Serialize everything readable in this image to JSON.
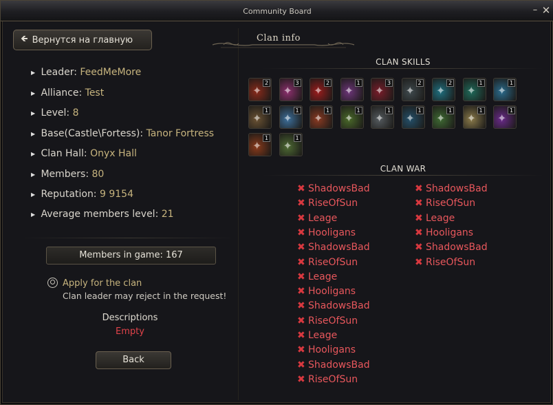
{
  "window": {
    "title": "Community Board",
    "minimize": "–",
    "close": "✕"
  },
  "home_button": {
    "label": "Вернутся на главную",
    "icon": "back-arrow-icon"
  },
  "header": {
    "title": "Clan info"
  },
  "info": {
    "leader": {
      "label": "Leader:",
      "value": "FeedMeMore"
    },
    "alliance": {
      "label": "Alliance:",
      "value": "Test"
    },
    "level": {
      "label": "Level:",
      "value": "8"
    },
    "base": {
      "label": "Base(Castle\\Fortess):",
      "value": "Tanor Fortress"
    },
    "hall": {
      "label": "Clan Hall:",
      "value": "Onyx Hall"
    },
    "members": {
      "label": "Members:",
      "value": "80"
    },
    "reputation": {
      "label": "Reputation:",
      "value": "9 9154"
    },
    "avg_level": {
      "label": "Average members level:",
      "value": "21"
    }
  },
  "members_in_game": "Members in game: 167",
  "apply": {
    "link": "Apply for the clan",
    "note": "Clan leader may reject in the request!"
  },
  "description": {
    "label": "Descriptions",
    "value": "Empty"
  },
  "back_button": "Back",
  "skills": {
    "title": "CLAN SKILLS",
    "items": [
      {
        "level": "2",
        "color": "#8a2a1a"
      },
      {
        "level": "3",
        "color": "#8d2f6e"
      },
      {
        "level": "2",
        "color": "#9b1c1c"
      },
      {
        "level": "1",
        "color": "#6d3579"
      },
      {
        "level": "3",
        "color": "#7a1d2a"
      },
      {
        "level": "2",
        "color": "#3f4a4e"
      },
      {
        "level": "2",
        "color": "#1f6f7f"
      },
      {
        "level": "1",
        "color": "#1f6a5a"
      },
      {
        "level": "1",
        "color": "#2a6b8c"
      },
      {
        "level": "1",
        "color": "#6b5233"
      },
      {
        "level": "1",
        "color": "#3d6f9a"
      },
      {
        "level": "1",
        "color": "#8a3a22"
      },
      {
        "level": "1",
        "color": "#4b6a2a"
      },
      {
        "level": "1",
        "color": "#555b5f"
      },
      {
        "level": "1",
        "color": "#24506a"
      },
      {
        "level": "1",
        "color": "#3f6a33"
      },
      {
        "level": "1",
        "color": "#8a7a4a"
      },
      {
        "level": "1",
        "color": "#6a2a8a"
      },
      {
        "level": "1",
        "color": "#8a3a1a"
      },
      {
        "level": "1",
        "color": "#4e6a33"
      }
    ]
  },
  "war": {
    "title": "CLAN WAR",
    "left": [
      "ShadowsBad",
      "RiseOfSun",
      "Leage",
      "Hooligans",
      "ShadowsBad",
      "RiseOfSun",
      "Leage",
      "Hooligans",
      "ShadowsBad",
      "RiseOfSun",
      "Leage",
      "Hooligans",
      "ShadowsBad",
      "RiseOfSun"
    ],
    "right": [
      "ShadowsBad",
      "RiseOfSun",
      "Leage",
      "Hooligans",
      "ShadowsBad",
      "RiseOfSun"
    ]
  }
}
